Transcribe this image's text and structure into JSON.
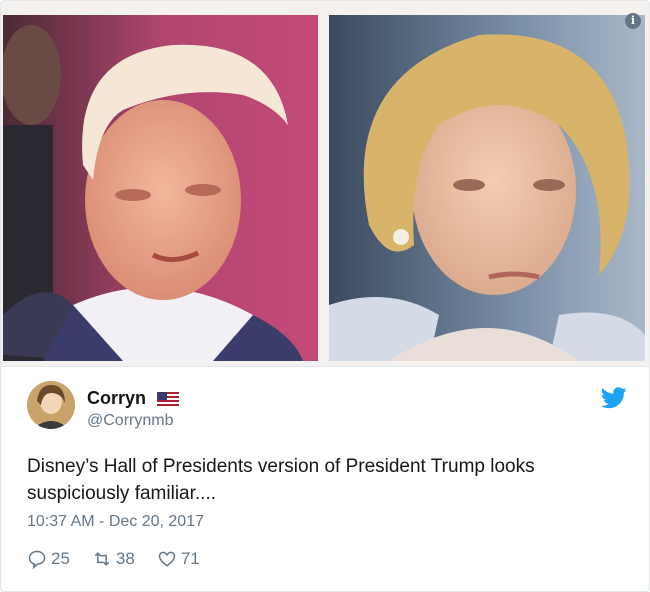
{
  "media": {
    "left_photo_icon": "portrait-photo",
    "right_photo_icon": "portrait-photo",
    "info_badge": "i"
  },
  "author": {
    "display_name": "Corryn",
    "handle": "@Corrynmb",
    "flag_icon": "us-flag-icon",
    "avatar_icon": "avatar"
  },
  "tweet": {
    "text": "Disney’s Hall of Presidents version of President Trump looks suspiciously familiar....",
    "timestamp": "10:37 AM - Dec 20, 2017"
  },
  "actions": {
    "replies": "25",
    "retweets": "38",
    "likes": "71"
  },
  "colors": {
    "twitter_blue": "#1da1f2",
    "secondary_text": "#657786",
    "primary_text": "#14171a"
  }
}
